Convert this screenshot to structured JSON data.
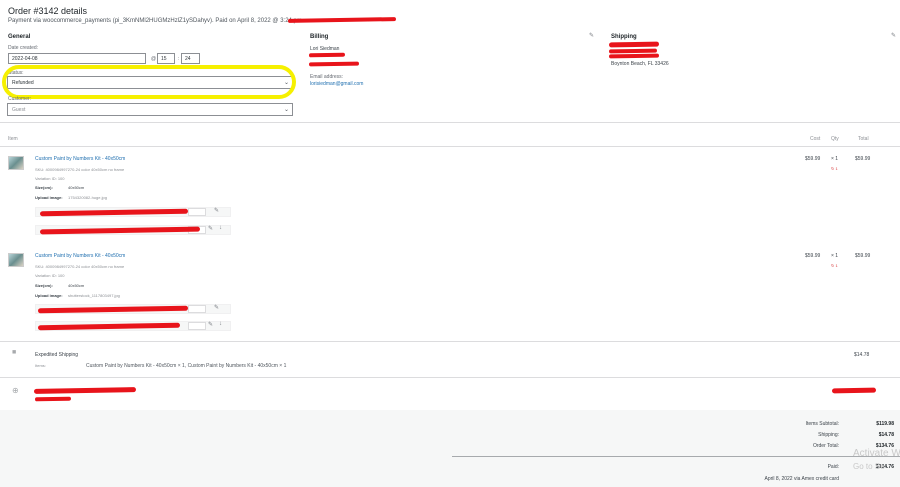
{
  "header": {
    "title": "Order #3142 details",
    "subtitle": "Payment via woocommerce_payments (pi_3KmNMl2HUGMzHzlZ1ySDahyv). Paid on April 8, 2022 @ 3:24 pm"
  },
  "general": {
    "heading": "General",
    "date_label": "Date created:",
    "date_value": "2022-04-08",
    "at": "@",
    "hour": "15",
    "minute": "24",
    "status_label": "Status:",
    "status_value": "Refunded",
    "customer_label": "Customer:",
    "customer_value": "Guest"
  },
  "billing": {
    "heading": "Billing",
    "name": "Lori Siedman",
    "email_label": "Email address:",
    "email": "lorisiedman@gmail.com"
  },
  "shipping": {
    "heading": "Shipping",
    "city": "Boynton Beach, FL 33426"
  },
  "items_header": {
    "item": "Item",
    "cost": "Cost",
    "qty": "Qty",
    "total": "Total"
  },
  "items": [
    {
      "name": "Custom Paint by Numbers Kit - 40x50cm",
      "sku": "SKU: 4000984997270-24 color 40x50cm no frame",
      "variation": "Variation ID: 100",
      "size_label": "Size(cm):",
      "size_value": "40x50cm",
      "upload_label": "Upload image:",
      "upload_file": "1754320082-huge.jpg",
      "cost": "$59.99",
      "qty": "× 1",
      "refund_qty": "↻ 1",
      "total": "$59.99"
    },
    {
      "name": "Custom Paint by Numbers Kit - 40x50cm",
      "sku": "SKU: 4000984997270-24 color 40x50cm no frame",
      "variation": "Variation ID: 100",
      "size_label": "Size(cm):",
      "size_value": "40x50cm",
      "upload_label": "Upload image:",
      "upload_file": "shutterstock_1117803497.jpg",
      "cost": "$59.99",
      "qty": "× 1",
      "refund_qty": "↻ 1",
      "total": "$59.99"
    }
  ],
  "shipping_line": {
    "name": "Expedited Shipping",
    "items_label": "Items:",
    "items_value": "Custom Paint by Numbers Kit - 40x50cm × 1, Custom Paint by Numbers Kit - 40x50cm × 1",
    "total": "$14.78"
  },
  "totals": {
    "subtotal_label": "Items Subtotal:",
    "subtotal": "$119.98",
    "shipping_label": "Shipping:",
    "shipping": "$14.78",
    "order_total_label": "Order Total:",
    "order_total": "$134.76",
    "paid_label": "Paid:",
    "paid": "$134.76",
    "paid_note": "April 8, 2022 via Amex credit card"
  },
  "watermark": {
    "line1": "Activate W",
    "line2": "Go to Se"
  },
  "colors": {
    "redaction": "#e8141b",
    "highlight": "#f6f000",
    "link": "#2271b1"
  }
}
